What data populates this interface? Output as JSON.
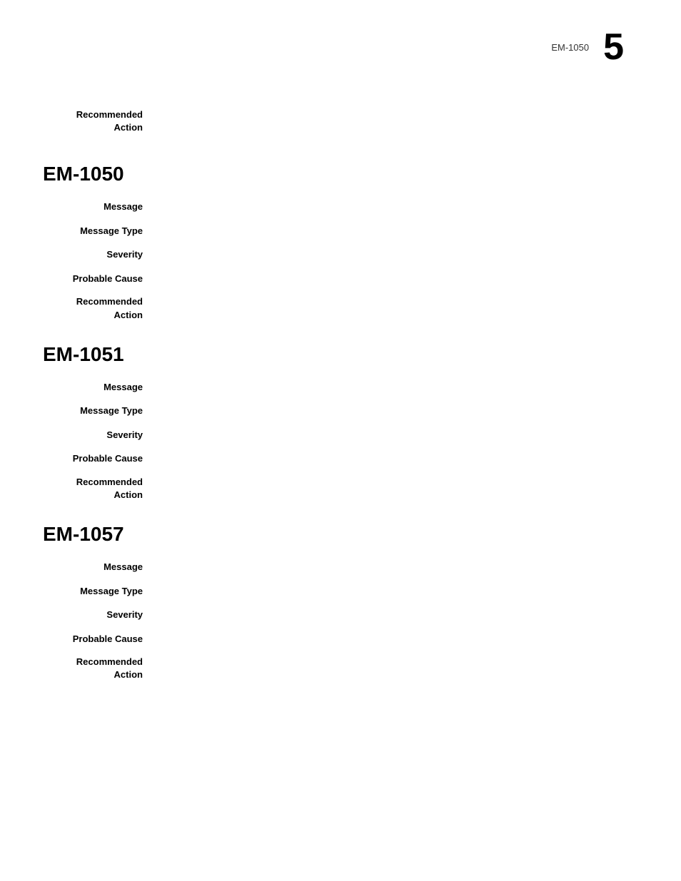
{
  "header": {
    "code": "EM-1050",
    "page_number": "5"
  },
  "intro": {
    "recommended_action_label": "Recommended\nAction"
  },
  "sections": [
    {
      "id": "em-1050",
      "title": "EM-1050",
      "fields": [
        {
          "label": "Message",
          "value": ""
        },
        {
          "label": "Message Type",
          "value": ""
        },
        {
          "label": "Severity",
          "value": ""
        },
        {
          "label": "Probable Cause",
          "value": ""
        },
        {
          "label": "Recommended\nAction",
          "value": "",
          "multiline": true
        }
      ]
    },
    {
      "id": "em-1051",
      "title": "EM-1051",
      "fields": [
        {
          "label": "Message",
          "value": ""
        },
        {
          "label": "Message Type",
          "value": ""
        },
        {
          "label": "Severity",
          "value": ""
        },
        {
          "label": "Probable Cause",
          "value": ""
        },
        {
          "label": "Recommended\nAction",
          "value": "",
          "multiline": true
        }
      ]
    },
    {
      "id": "em-1057",
      "title": "EM-1057",
      "fields": [
        {
          "label": "Message",
          "value": ""
        },
        {
          "label": "Message Type",
          "value": ""
        },
        {
          "label": "Severity",
          "value": ""
        },
        {
          "label": "Probable Cause",
          "value": ""
        },
        {
          "label": "Recommended\nAction",
          "value": "",
          "multiline": true
        }
      ]
    }
  ]
}
